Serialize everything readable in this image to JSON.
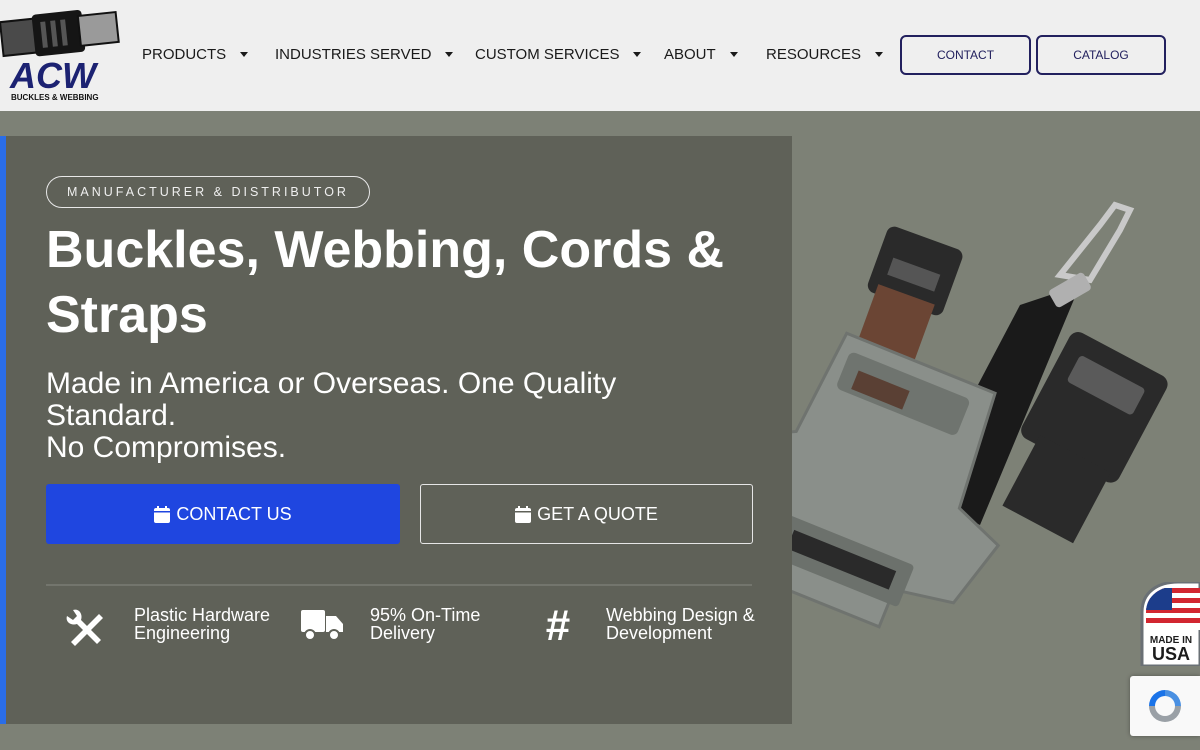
{
  "logo": {
    "text": "ACW",
    "tagline": "BUCKLES & WEBBING"
  },
  "nav": [
    {
      "label": "PRODUCTS"
    },
    {
      "label": "INDUSTRIES SERVED"
    },
    {
      "label": "CUSTOM SERVICES"
    },
    {
      "label": "ABOUT"
    },
    {
      "label": "RESOURCES"
    }
  ],
  "header_buttons": {
    "contact": "CONTACT",
    "catalog": "CATALOG"
  },
  "hero": {
    "badge": "MANUFACTURER & DISTRIBUTOR",
    "title": "Buckles, Webbing, Cords & Straps",
    "subtitle_line1": "Made in America or Overseas. One Quality Standard.",
    "subtitle_line2": "No Compromises.",
    "cta_primary": "CONTACT US",
    "cta_secondary": "GET A QUOTE"
  },
  "features": [
    {
      "icon": "tools-icon",
      "label": "Plastic Hardware Engineering"
    },
    {
      "icon": "truck-icon",
      "label": "95% On-Time Delivery"
    },
    {
      "icon": "hashtag-icon",
      "label": "Webbing Design & Development"
    }
  ],
  "usa_badge": {
    "line1": "MADE IN",
    "line2": "USA"
  },
  "colors": {
    "header_bg": "#efefef",
    "page_bg": "#7d8176",
    "hero_bg": "#5f6158",
    "accent_blue": "#1f46e0",
    "left_bar": "#2a6de8",
    "nav_button_border": "#22205e"
  }
}
